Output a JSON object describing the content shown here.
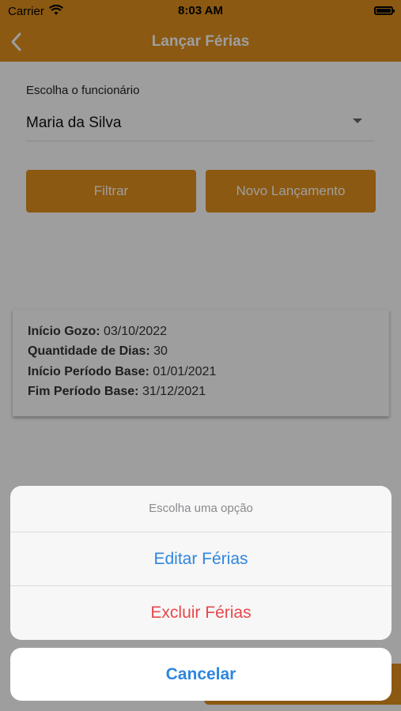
{
  "status_bar": {
    "carrier": "Carrier",
    "time": "8:03 AM"
  },
  "navbar": {
    "title": "Lançar Férias"
  },
  "employee_field": {
    "label": "Escolha o funcionário",
    "value": "Maria da Silva"
  },
  "buttons": {
    "filter": "Filtrar",
    "new_entry": "Novo Lançamento"
  },
  "card": {
    "lines": [
      {
        "label": "Início Gozo:",
        "value": "03/10/2022"
      },
      {
        "label": "Quantidade de Dias:",
        "value": "30"
      },
      {
        "label": "Início Período Base:",
        "value": "01/01/2021"
      },
      {
        "label": "Fim Período Base:",
        "value": "31/12/2021"
      }
    ]
  },
  "action_sheet": {
    "title": "Escolha uma opção",
    "edit_label": "Editar Férias",
    "delete_label": "Excluir Férias",
    "cancel_label": "Cancelar"
  },
  "colors": {
    "brand": "#E0901E",
    "action_blue": "#2F86DE",
    "destructive_red": "#E8484B"
  },
  "icons": [
    "wifi-icon",
    "battery-icon",
    "back-chevron-icon",
    "dropdown-arrow-icon"
  ]
}
